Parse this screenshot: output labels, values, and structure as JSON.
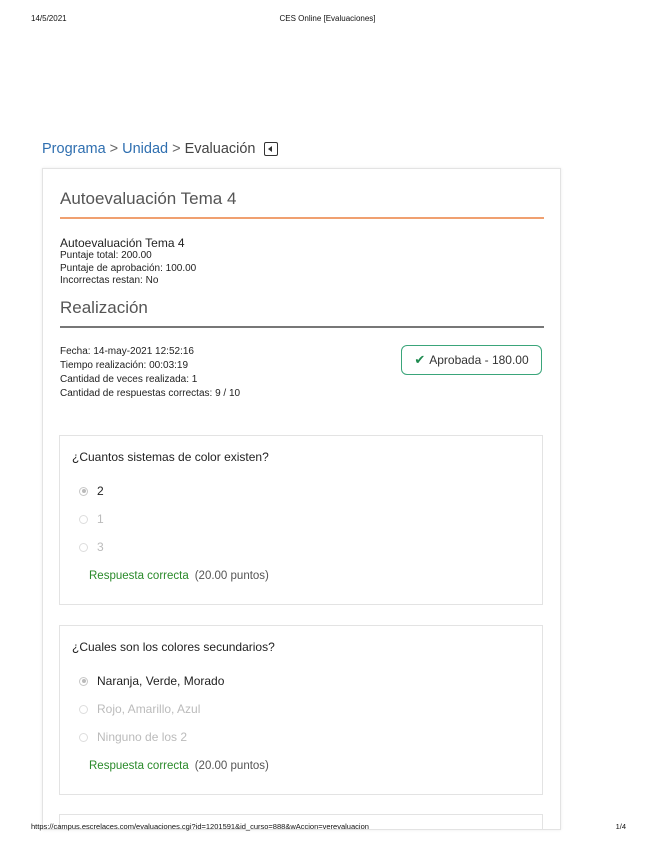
{
  "print_header": {
    "date": "14/5/2021",
    "title": "CES Online [Evaluaciones]"
  },
  "breadcrumb": {
    "items": [
      "Programa",
      "Unidad",
      "Evaluación"
    ],
    "separator": ">",
    "back_icon": "back-arrow-icon"
  },
  "evaluation": {
    "title": "Autoevaluación Tema 4",
    "name": "Autoevaluación Tema 4",
    "total_score": "Puntaje total: 200.00",
    "pass_score": "Puntaje de aprobación: 100.00",
    "wrong_subtract": "Incorrectas restan: No"
  },
  "attempt": {
    "section_title": "Realización",
    "date": "Fecha: 14-may-2021 12:52:16",
    "time": "Tiempo realización: 00:03:19",
    "times_taken": "Cantidad de veces realizada: 1",
    "correct_answers": "Cantidad de respuestas correctas: 9 / 10",
    "status": "Aprobada - 180.00",
    "status_icon": "check-icon"
  },
  "questions": [
    {
      "text": "¿Cuantos sistemas de color existen?",
      "options": [
        "2",
        "1",
        "3"
      ],
      "selected_index": 0,
      "result": "Respuesta correcta",
      "points": "(20.00 puntos)"
    },
    {
      "text": "¿Cuales son los colores secundarios?",
      "options": [
        "Naranja, Verde, Morado",
        "Rojo, Amarillo, Azul",
        "Ninguno de los 2"
      ],
      "selected_index": 0,
      "result": "Respuesta correcta",
      "points": "(20.00 puntos)"
    }
  ],
  "print_footer": {
    "url": "https://campus.escrelaces.com/evaluaciones.cgi?id=1201591&id_curso=888&wAccion=verevaluacion",
    "page": "1/4"
  },
  "colors": {
    "link": "#2f6fb0",
    "accent_rule": "#f0a070",
    "success": "#2a8a2a",
    "badge_border": "#3aa57a"
  }
}
